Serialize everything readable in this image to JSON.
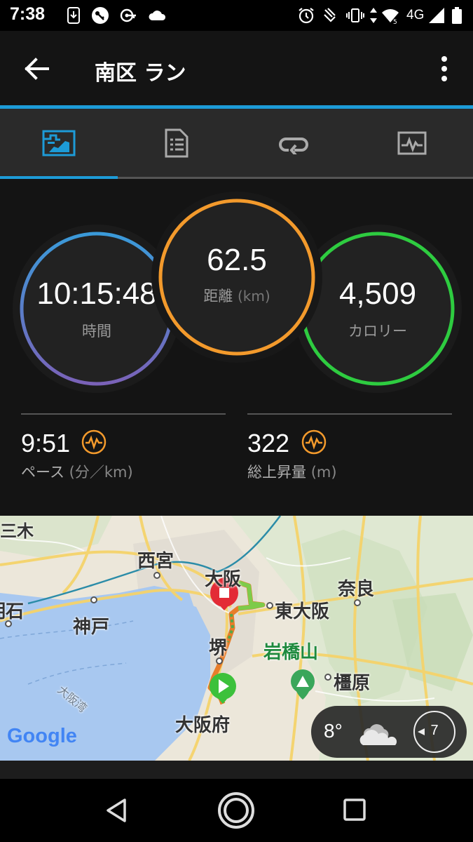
{
  "status_bar": {
    "time": "7:38",
    "network": "4G",
    "icons_left": [
      "download-icon",
      "key-icon",
      "vpn-icon",
      "cloud-icon"
    ],
    "icons_right": [
      "alarm-icon",
      "nfc-icon",
      "vibrate-icon",
      "data-arrows-icon",
      "wifi-icon",
      "signal-icon",
      "battery-icon"
    ]
  },
  "app_bar": {
    "title": "南区 ラン",
    "back_icon": "arrow-left-icon",
    "menu_icon": "more-vertical-icon"
  },
  "tabs": [
    {
      "name": "overview",
      "icon": "map-stats-icon",
      "selected": true
    },
    {
      "name": "details",
      "icon": "document-icon",
      "selected": false
    },
    {
      "name": "laps",
      "icon": "loop-icon",
      "selected": false
    },
    {
      "name": "charts",
      "icon": "chart-icon",
      "selected": false
    }
  ],
  "summary": {
    "time": {
      "value": "10:15:48",
      "label": "時間"
    },
    "distance": {
      "value": "62.5",
      "label": "距離",
      "unit": "(km)"
    },
    "calories": {
      "value": "4,509",
      "label": "カロリー"
    }
  },
  "stats": {
    "pace": {
      "value": "9:51",
      "label": "ペース",
      "unit": "(分／km)"
    },
    "elevation": {
      "value": "322",
      "label": "総上昇量",
      "unit": "(m)"
    }
  },
  "map": {
    "labels": {
      "kobe_partial": "三木",
      "nishinomiya": "西宮",
      "osaka": "大阪",
      "nara": "奈良",
      "akashi": "明石",
      "kobe": "神戸",
      "higashiosaka": "東大阪",
      "sakai": "堺",
      "iwahashiyama": "岩橋山",
      "kashihara": "橿原",
      "osaka_bay": "大阪湾",
      "osaka_fu": "大阪府"
    },
    "google": "Google",
    "weather": {
      "temp": "8°",
      "wind": "7"
    }
  },
  "colors": {
    "time_ring": "#3a9ad9",
    "distance_ring": "#f39a2c",
    "calories_ring": "#2ecc40",
    "accent": "#1d9bd7"
  }
}
